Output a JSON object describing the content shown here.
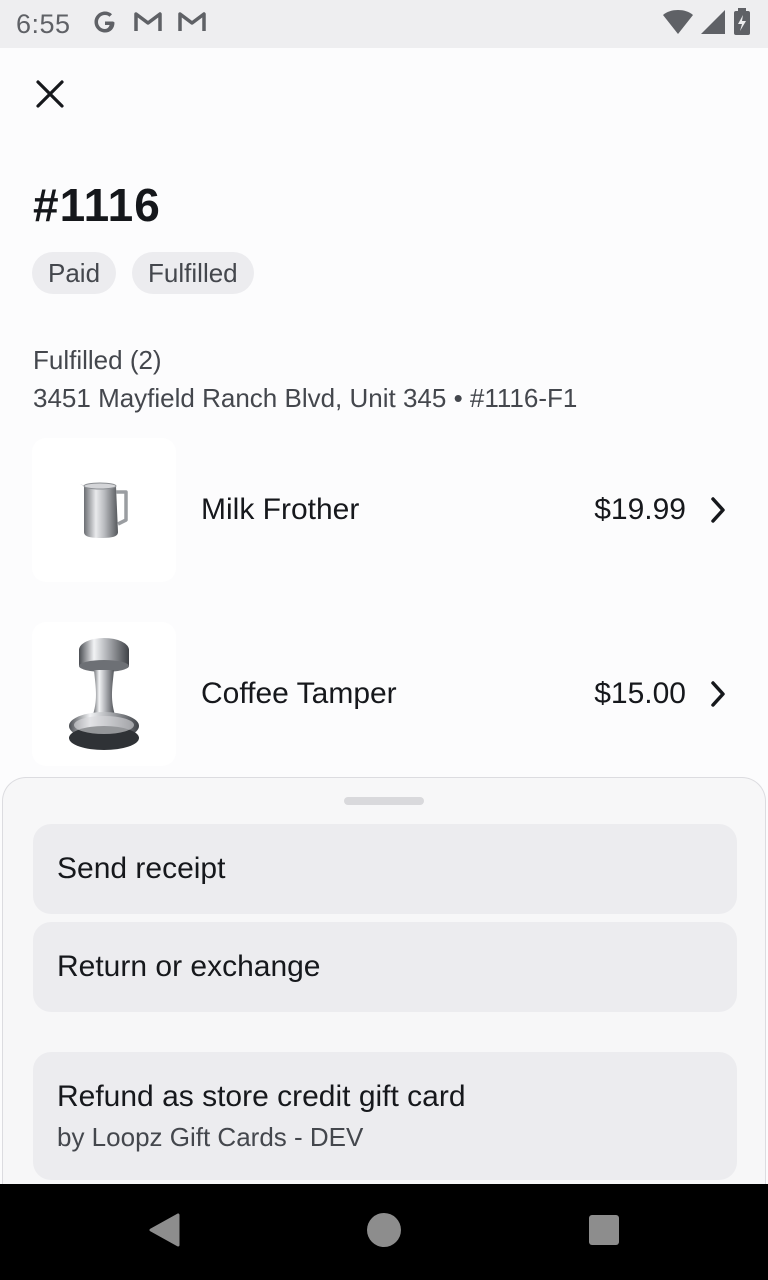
{
  "status_bar": {
    "time": "6:55",
    "app_icons": [
      "google-icon",
      "gmail-icon",
      "gmail-icon"
    ],
    "system_icons": [
      "wifi-icon",
      "signal-icon",
      "battery-charging-icon"
    ]
  },
  "header": {
    "close_icon": "close-icon"
  },
  "order": {
    "title": "#1116",
    "badges": [
      "Paid",
      "Fulfilled"
    ]
  },
  "fulfillment": {
    "title": "Fulfilled (2)",
    "address": "3451 Mayfield Ranch Blvd, Unit 345 • #1116-F1",
    "items": [
      {
        "name": "Milk Frother",
        "price": "$19.99",
        "image": "milk-pitcher-image"
      },
      {
        "name": "Coffee Tamper",
        "price": "$15.00",
        "image": "coffee-tamper-image"
      }
    ]
  },
  "sheet": {
    "actions": [
      {
        "label": "Send receipt"
      },
      {
        "label": "Return or exchange"
      },
      {
        "label": "Refund as store credit gift card",
        "sublabel": "by Loopz Gift Cards - DEV"
      }
    ]
  },
  "colors": {
    "background": "#fcfcfd",
    "badge_bg": "#ececef",
    "text_primary": "#16181c",
    "text_secondary": "#44474d"
  }
}
